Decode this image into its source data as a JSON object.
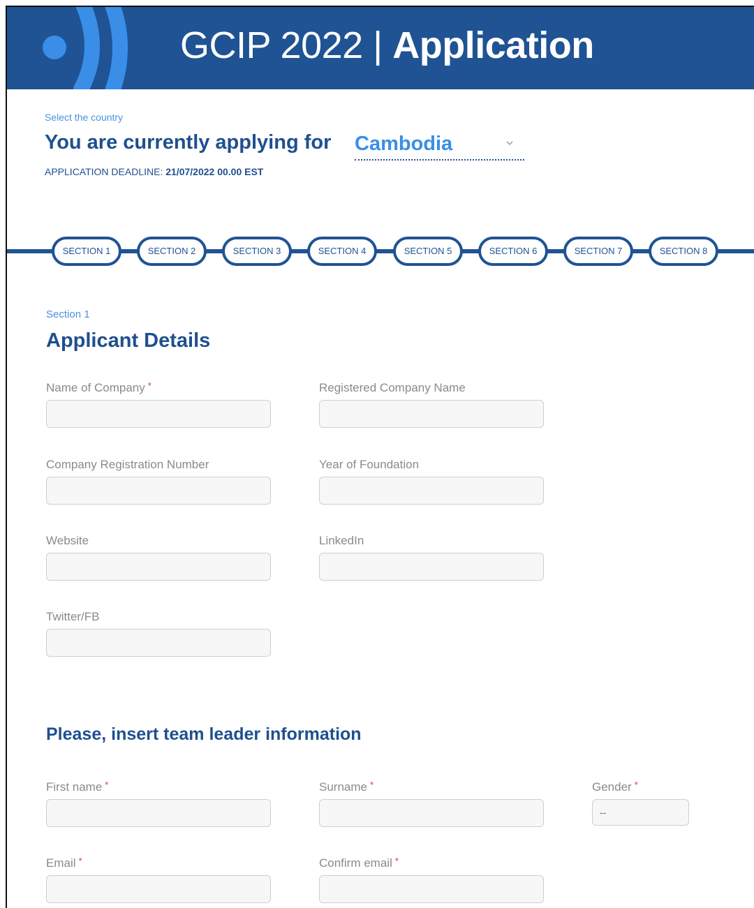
{
  "header": {
    "logo_name": "gcip-logo",
    "title_light": "GCIP 2022 | ",
    "title_bold": "Application"
  },
  "country": {
    "hint": "Select the country",
    "applying_text": "You are currently applying for",
    "selected": "Cambodia",
    "deadline_label": "APPLICATION DEADLINE: ",
    "deadline_value": "21/07/2022 00.00 EST"
  },
  "sections": [
    "SECTION 1",
    "SECTION 2",
    "SECTION 3",
    "SECTION 4",
    "SECTION 5",
    "SECTION 6",
    "SECTION 7",
    "SECTION 8"
  ],
  "section1": {
    "label": "Section 1",
    "heading": "Applicant Details",
    "fields": {
      "company_name": "Name of Company",
      "registered_name": "Registered Company Name",
      "registration_number": "Company Registration Number",
      "year_foundation": "Year of Foundation",
      "website": "Website",
      "linkedin": "LinkedIn",
      "twitter_fb": "Twitter/FB"
    }
  },
  "team_leader": {
    "heading": "Please, insert team leader information",
    "fields": {
      "first_name": "First name",
      "surname": "Surname",
      "gender": "Gender",
      "gender_value": "--",
      "email": "Email",
      "confirm_email": "Confirm email"
    }
  },
  "required_marker": "*",
  "colors": {
    "brand_blue": "#1f5394",
    "accent_blue": "#3a8ee8",
    "required_red": "#e03131"
  }
}
